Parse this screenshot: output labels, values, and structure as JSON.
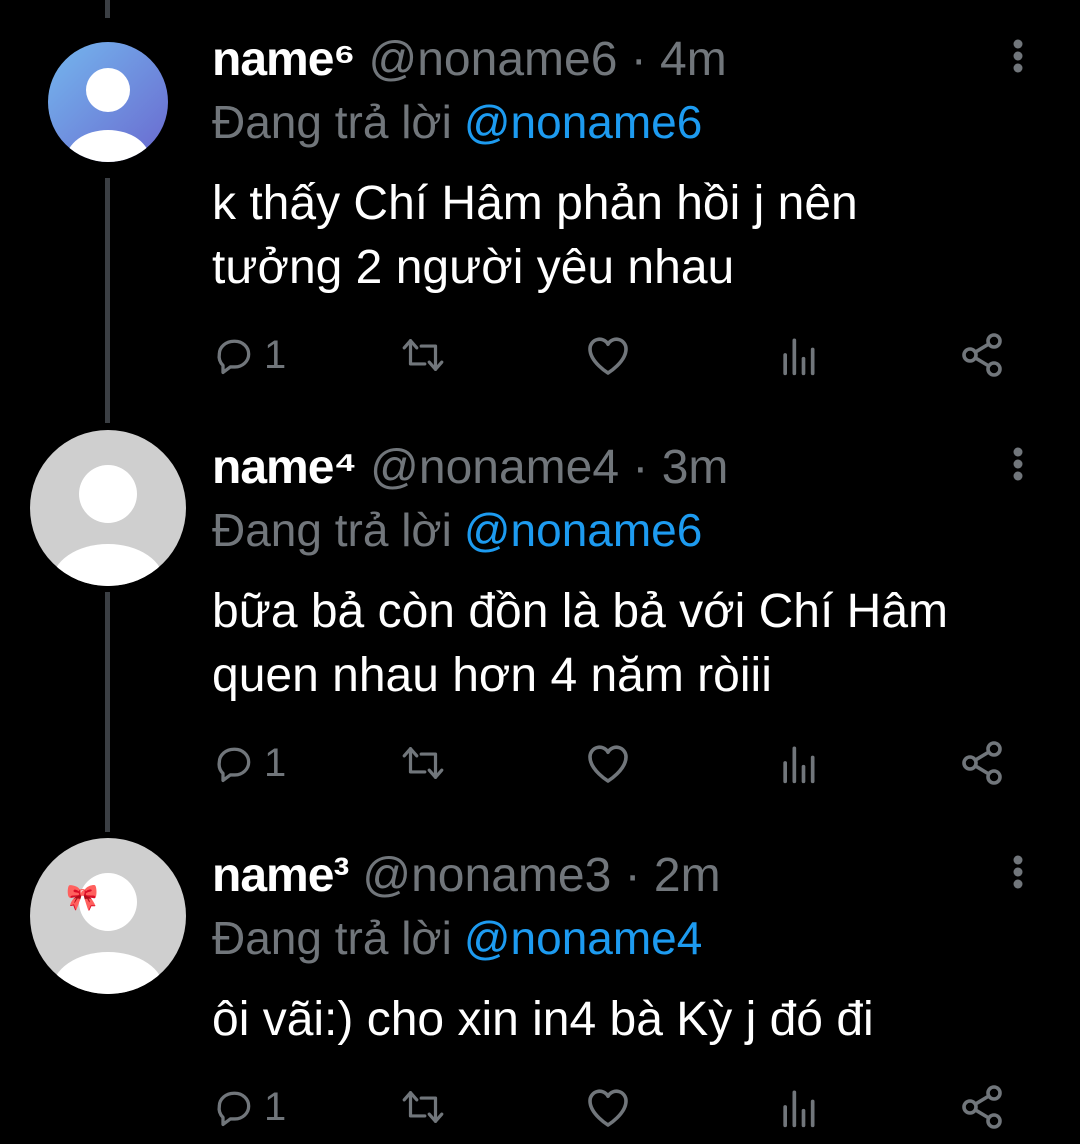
{
  "colors": {
    "background": "#000000",
    "text_primary": "#ffffff",
    "text_secondary": "#71767b",
    "link": "#1d9bf0",
    "thread_line": "#3b3f44"
  },
  "tweets": [
    {
      "name": "name⁶",
      "handle": "@noname6",
      "time": "· 4m",
      "reply_prefix": "Đang trả lời",
      "reply_to": "@noname6",
      "text_lines": [
        "k thấy Chí Hâm phản hồi j nên",
        "tưởng 2 người yêu nhau"
      ],
      "reply_count": "1",
      "avatar": "default-blue"
    },
    {
      "name": "name⁴",
      "handle": "@noname4",
      "time": "· 3m",
      "reply_prefix": "Đang trả lời",
      "reply_to": "@noname6",
      "text_lines": [
        "bữa bả còn đồn là bả với Chí Hâm",
        "quen nhau hơn 4 năm ròiii"
      ],
      "reply_count": "1",
      "avatar": "default-gray"
    },
    {
      "name": "name³",
      "handle": "@noname3",
      "time": "· 2m",
      "reply_prefix": "Đang trả lời",
      "reply_to": "@noname4",
      "text_lines": [
        "ôi vãi:) cho xin in4 bà Kỳ j đó đi"
      ],
      "reply_count": "1",
      "avatar": "default-gray-bow"
    }
  ],
  "icons": {
    "reply": "reply-icon",
    "retweet": "retweet-icon",
    "like": "heart-icon",
    "views": "views-icon",
    "share": "share-icon",
    "more": "more-icon",
    "avatar_decoration": "🎀"
  }
}
